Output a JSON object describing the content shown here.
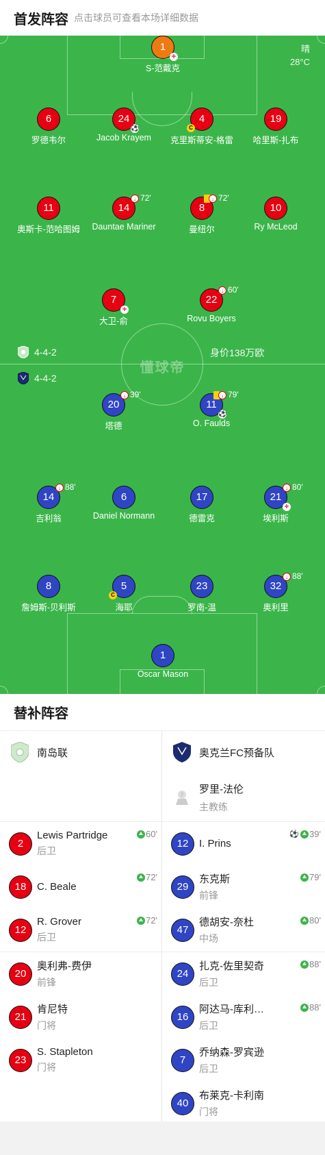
{
  "header": {
    "title": "首发阵容",
    "subtitle": "点击球员可查看本场详细数据"
  },
  "weather": {
    "condition": "晴",
    "temperature": "28°C"
  },
  "watermark": "懂球帝",
  "home": {
    "formation": "4-4-2",
    "value": "身价138万欧",
    "name": "南岛联"
  },
  "away": {
    "formation": "4-4-2",
    "name": "奥克兰FC预备队"
  },
  "home_lineup": [
    {
      "num": "1",
      "name": "S-范戴克",
      "color": "orange",
      "events": [
        "injury"
      ]
    },
    {
      "num": "6",
      "name": "罗德韦尔",
      "color": "red",
      "events": []
    },
    {
      "num": "24",
      "name": "Jacob Krayem",
      "color": "red",
      "events": [
        "goal"
      ]
    },
    {
      "num": "4",
      "name": "克里斯蒂安-格雷",
      "color": "red",
      "events": [
        "cap"
      ]
    },
    {
      "num": "19",
      "name": "哈里斯-扎布",
      "color": "red",
      "events": []
    },
    {
      "num": "11",
      "name": "奥斯卡-范哈图姆",
      "color": "red",
      "events": []
    },
    {
      "num": "14",
      "name": "Dauntae Mariner",
      "color": "red",
      "events": [
        "sub"
      ],
      "minute": "72'"
    },
    {
      "num": "8",
      "name": "曼纽尔",
      "color": "red",
      "events": [
        "yellow",
        "sub"
      ],
      "minute": "72'"
    },
    {
      "num": "10",
      "name": "Ry McLeod",
      "color": "red",
      "events": []
    },
    {
      "num": "7",
      "name": "大卫-俞",
      "color": "red",
      "events": [
        "injury"
      ]
    },
    {
      "num": "22",
      "name": "Rovu Boyers",
      "color": "red",
      "events": [
        "sub"
      ],
      "minute": "60'"
    }
  ],
  "away_lineup": [
    {
      "num": "20",
      "name": "塔德",
      "color": "blue",
      "events": [
        "sub"
      ],
      "minute": "39'"
    },
    {
      "num": "11",
      "name": "O. Faulds",
      "color": "blue",
      "events": [
        "yellow",
        "sub",
        "goal"
      ],
      "minute": "79'"
    },
    {
      "num": "14",
      "name": "吉利翁",
      "color": "blue",
      "events": [
        "sub"
      ],
      "minute": "88'"
    },
    {
      "num": "6",
      "name": "Daniel Normann",
      "color": "blue",
      "events": []
    },
    {
      "num": "17",
      "name": "德雷克",
      "color": "blue",
      "events": []
    },
    {
      "num": "21",
      "name": "埃利斯",
      "color": "blue",
      "events": [
        "sub",
        "injury"
      ],
      "minute": "80'"
    },
    {
      "num": "8",
      "name": "詹姆斯-贝利斯",
      "color": "blue",
      "events": []
    },
    {
      "num": "5",
      "name": "海耶",
      "color": "blue",
      "events": [
        "cap"
      ]
    },
    {
      "num": "23",
      "name": "罗南-温",
      "color": "blue",
      "events": []
    },
    {
      "num": "32",
      "name": "奥利里",
      "color": "blue",
      "events": [
        "sub"
      ],
      "minute": "88'"
    },
    {
      "num": "1",
      "name": "Oscar Mason",
      "color": "blue",
      "events": []
    }
  ],
  "subs": {
    "title": "替补阵容",
    "away_coach": {
      "name": "罗里-法伦",
      "role": "主教练"
    },
    "home": [
      {
        "num": "2",
        "name": "Lewis Partridge",
        "pos": "后卫",
        "in": "60'"
      },
      {
        "num": "18",
        "name": "C. Beale",
        "pos": "",
        "in": "72'"
      },
      {
        "num": "12",
        "name": "R. Grover",
        "pos": "后卫",
        "in": "72'"
      },
      {
        "num": "20",
        "name": "奥利弗-费伊",
        "pos": "前锋",
        "in": ""
      },
      {
        "num": "21",
        "name": "肯尼特",
        "pos": "门将",
        "in": ""
      },
      {
        "num": "23",
        "name": "S. Stapleton",
        "pos": "门将",
        "in": ""
      }
    ],
    "away": [
      {
        "num": "12",
        "name": "I. Prins",
        "pos": "",
        "in": "39'",
        "goal": true
      },
      {
        "num": "29",
        "name": "东克斯",
        "pos": "前锋",
        "in": "79'"
      },
      {
        "num": "47",
        "name": "德胡安-奈杜",
        "pos": "中场",
        "in": "80'"
      },
      {
        "num": "24",
        "name": "扎克-佐里契奇",
        "pos": "后卫",
        "in": "88'"
      },
      {
        "num": "16",
        "name": "阿达马-库利…",
        "pos": "后卫",
        "in": "88'"
      },
      {
        "num": "7",
        "name": "乔纳森-罗宾逊",
        "pos": "后卫",
        "in": ""
      },
      {
        "num": "40",
        "name": "布莱克-卡利南",
        "pos": "门将",
        "in": ""
      }
    ]
  }
}
